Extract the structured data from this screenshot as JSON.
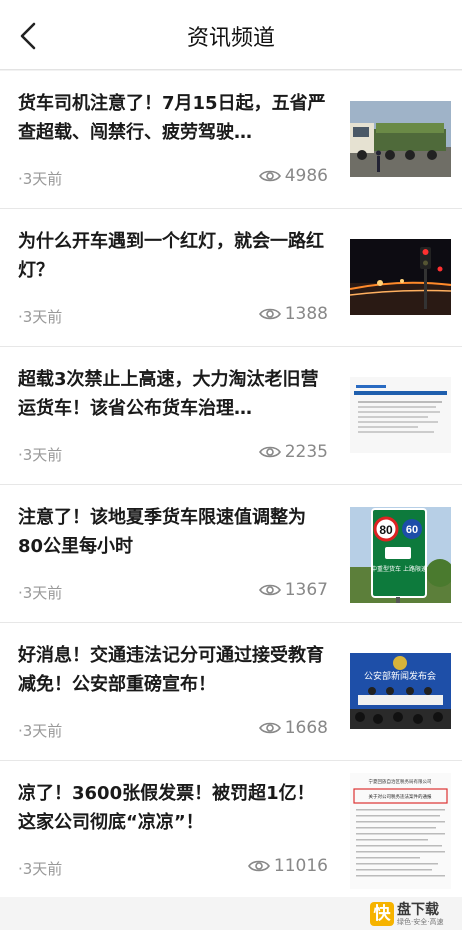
{
  "header": {
    "title": "资讯频道"
  },
  "articles": [
    {
      "title": "货车司机注意了！7月15日起，五省严查超载、闯禁行、疲劳驾驶…",
      "time": "·3天前",
      "views": "4986"
    },
    {
      "title": "为什么开车遇到一个红灯，就会一路红灯？",
      "time": "·3天前",
      "views": "1388"
    },
    {
      "title": "超载3次禁止上高速，大力淘汰老旧营运货车！该省公布货车治理…",
      "time": "·3天前",
      "views": "2235"
    },
    {
      "title": "注意了！该地夏季货车限速值调整为80公里每小时",
      "time": "·3天前",
      "views": "1367"
    },
    {
      "title": "好消息！交通违法记分可通过接受教育减免！公安部重磅宣布！",
      "time": "·3天前",
      "views": "1668"
    },
    {
      "title": "凉了！3600张假发票！被罚超1亿！这家公司彻底“凉凉”！",
      "time": "·3天前",
      "views": "11016"
    }
  ],
  "thumbs": {
    "sign": {
      "speed_left": "80",
      "speed_right": "60",
      "caption": "中重型货车 上路限速"
    },
    "press": {
      "banner": "公安部新闻发布会"
    },
    "doc": {
      "line1": "宁夏回族自治区税务局有限公司",
      "line2": "关于对公司税务违法案件的通报"
    }
  },
  "logo": {
    "mark": "快",
    "name": "盘下载",
    "sub": "绿色·安全·高速"
  },
  "colors": {
    "accent": "#f6b300"
  }
}
